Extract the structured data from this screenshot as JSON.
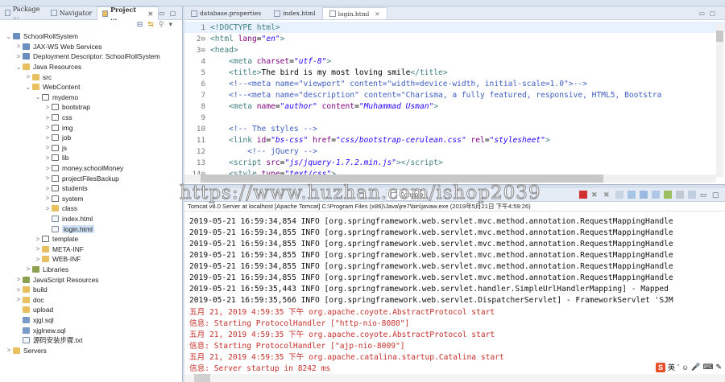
{
  "explorer": {
    "tabs": [
      {
        "label": "Package ..."
      },
      {
        "label": "Navigator"
      },
      {
        "label": "Project ..."
      }
    ],
    "tree": [
      {
        "label": "SchoolRollSystem",
        "depth": 0,
        "arrow": "v",
        "icon": "proj"
      },
      {
        "label": "JAX-WS Web Services",
        "depth": 1,
        "arrow": ">",
        "icon": "proj"
      },
      {
        "label": "Deployment Descriptor: SchoolRollSystem",
        "depth": 1,
        "arrow": ">",
        "icon": "proj"
      },
      {
        "label": "Java Resources",
        "depth": 1,
        "arrow": "v",
        "icon": "fold"
      },
      {
        "label": "src",
        "depth": 2,
        "arrow": ">",
        "icon": "fold"
      },
      {
        "label": "WebContent",
        "depth": 2,
        "arrow": "v",
        "icon": "fold"
      },
      {
        "label": "mydemo",
        "depth": 3,
        "arrow": "v",
        "icon": "pkg"
      },
      {
        "label": "bootstrap",
        "depth": 4,
        "arrow": ">",
        "icon": "pkg"
      },
      {
        "label": "css",
        "depth": 4,
        "arrow": ">",
        "icon": "pkg"
      },
      {
        "label": "img",
        "depth": 4,
        "arrow": ">",
        "icon": "pkg"
      },
      {
        "label": "job",
        "depth": 4,
        "arrow": ">",
        "icon": "pkg"
      },
      {
        "label": "js",
        "depth": 4,
        "arrow": ">",
        "icon": "pkg"
      },
      {
        "label": "lib",
        "depth": 4,
        "arrow": ">",
        "icon": "pkg"
      },
      {
        "label": "money.schoolMoney",
        "depth": 4,
        "arrow": ">",
        "icon": "pkg"
      },
      {
        "label": "projectFilesBackup",
        "depth": 4,
        "arrow": ">",
        "icon": "pkg"
      },
      {
        "label": "students",
        "depth": 4,
        "arrow": ">",
        "icon": "pkg"
      },
      {
        "label": "system",
        "depth": 4,
        "arrow": ">",
        "icon": "pkg"
      },
      {
        "label": "class",
        "depth": 4,
        "arrow": ">",
        "icon": "fold"
      },
      {
        "label": "index.html",
        "depth": 4,
        "arrow": "",
        "icon": "file"
      },
      {
        "label": "login.html",
        "depth": 4,
        "arrow": "",
        "icon": "file",
        "selected": true
      },
      {
        "label": "template",
        "depth": 3,
        "arrow": ">",
        "icon": "pkg"
      },
      {
        "label": "META-INF",
        "depth": 3,
        "arrow": ">",
        "icon": "fold"
      },
      {
        "label": "WEB-INF",
        "depth": 3,
        "arrow": ">",
        "icon": "fold"
      },
      {
        "label": "Libraries",
        "depth": 2,
        "arrow": ">",
        "icon": "lib"
      },
      {
        "label": "JavaScript Resources",
        "depth": 1,
        "arrow": ">",
        "icon": "lib"
      },
      {
        "label": "build",
        "depth": 1,
        "arrow": ">",
        "icon": "fold"
      },
      {
        "label": "doc",
        "depth": 1,
        "arrow": ">",
        "icon": "fold"
      },
      {
        "label": "upload",
        "depth": 1,
        "arrow": "",
        "icon": "fold"
      },
      {
        "label": "xjgl.sql",
        "depth": 1,
        "arrow": "",
        "icon": "sql"
      },
      {
        "label": "xjglnew.sql",
        "depth": 1,
        "arrow": "",
        "icon": "sql"
      },
      {
        "label": "源码安装步骤.txt",
        "depth": 1,
        "arrow": "",
        "icon": "file"
      },
      {
        "label": "Servers",
        "depth": 0,
        "arrow": ">",
        "icon": "fold"
      }
    ]
  },
  "editor": {
    "tabs": [
      {
        "label": "database.properties"
      },
      {
        "label": "index.html"
      },
      {
        "label": "login.html"
      }
    ],
    "lines": [
      {
        "n": "1",
        "parts": [
          [
            "tag",
            "<!DOCTYPE html>"
          ]
        ]
      },
      {
        "n": "2⊖",
        "parts": [
          [
            "tag",
            "<html "
          ],
          [
            "attr",
            "lang"
          ],
          [
            "txt",
            "="
          ],
          [
            "val",
            "\"en\""
          ],
          [
            "tag",
            ">"
          ]
        ]
      },
      {
        "n": "3⊖",
        "parts": [
          [
            "tag",
            "<head>"
          ]
        ]
      },
      {
        "n": "4",
        "parts": [
          [
            "txt",
            "    "
          ],
          [
            "tag",
            "<meta "
          ],
          [
            "attr",
            "charset"
          ],
          [
            "txt",
            "="
          ],
          [
            "val",
            "\"utf-8\""
          ],
          [
            "tag",
            ">"
          ]
        ]
      },
      {
        "n": "5",
        "parts": [
          [
            "txt",
            "    "
          ],
          [
            "tag",
            "<title>"
          ],
          [
            "txt",
            "The bird is my most loving smile"
          ],
          [
            "tag",
            "</title>"
          ]
        ]
      },
      {
        "n": "6",
        "parts": [
          [
            "txt",
            "    "
          ],
          [
            "cmt",
            "<!--<meta name=\"viewport\" content=\"width=device-width, initial-scale=1.0\">-->"
          ]
        ]
      },
      {
        "n": "7",
        "parts": [
          [
            "txt",
            "    "
          ],
          [
            "cmt",
            "<!--<meta name=\"description\" content=\"Charisma, a fully featured, responsive, HTML5, Bootstra"
          ]
        ]
      },
      {
        "n": "8",
        "parts": [
          [
            "txt",
            "    "
          ],
          [
            "tag",
            "<meta "
          ],
          [
            "attr",
            "name"
          ],
          [
            "txt",
            "="
          ],
          [
            "val",
            "\"author\""
          ],
          [
            "attr",
            " content"
          ],
          [
            "txt",
            "="
          ],
          [
            "val",
            "\"Muhammad Usman\""
          ],
          [
            "tag",
            ">"
          ]
        ]
      },
      {
        "n": "9",
        "parts": []
      },
      {
        "n": "10",
        "parts": [
          [
            "txt",
            "    "
          ],
          [
            "cmt",
            "<!-- The styles -->"
          ]
        ]
      },
      {
        "n": "11",
        "parts": [
          [
            "txt",
            "    "
          ],
          [
            "tag",
            "<link "
          ],
          [
            "attr",
            "id"
          ],
          [
            "txt",
            "="
          ],
          [
            "val",
            "\"bs-css\""
          ],
          [
            "attr",
            " href"
          ],
          [
            "txt",
            "="
          ],
          [
            "val",
            "\"css/bootstrap-cerulean.css\""
          ],
          [
            "attr",
            " rel"
          ],
          [
            "txt",
            "="
          ],
          [
            "val",
            "\"stylesheet\""
          ],
          [
            "tag",
            ">"
          ]
        ]
      },
      {
        "n": "12",
        "parts": [
          [
            "txt",
            "        "
          ],
          [
            "cmt",
            "<!-- jQuery -->"
          ]
        ]
      },
      {
        "n": "13",
        "parts": [
          [
            "txt",
            "    "
          ],
          [
            "tag",
            "<script "
          ],
          [
            "attr",
            "src"
          ],
          [
            "txt",
            "="
          ],
          [
            "val",
            "\"js/jquery-1.7.2.min.js\""
          ],
          [
            "tag",
            "></script>"
          ]
        ]
      },
      {
        "n": "14⊖",
        "parts": [
          [
            "txt",
            "    "
          ],
          [
            "tag",
            "<style "
          ],
          [
            "attr",
            "type"
          ],
          [
            "txt",
            "="
          ],
          [
            "val",
            "\"text/css\""
          ],
          [
            "tag",
            ">"
          ]
        ]
      }
    ]
  },
  "console": {
    "tab_label": "Console",
    "watermark": "https://www.huzhan.com/ishop2039",
    "header": "Tomcat v8.0 Server at localhost [Apache Tomcat] C:\\Program Files (x86)\\Java\\jre7\\bin\\javaw.exe (2019年5月21日 下午4:59:26)",
    "lines": [
      {
        "style": "blk",
        "text": "2019-05-21 16:59:34,854 INFO [org.springframework.web.servlet.mvc.method.annotation.RequestMappingHandle"
      },
      {
        "style": "blk",
        "text": "2019-05-21 16:59:34,855 INFO [org.springframework.web.servlet.mvc.method.annotation.RequestMappingHandle"
      },
      {
        "style": "blk",
        "text": "2019-05-21 16:59:34,855 INFO [org.springframework.web.servlet.mvc.method.annotation.RequestMappingHandle"
      },
      {
        "style": "blk",
        "text": "2019-05-21 16:59:34,855 INFO [org.springframework.web.servlet.mvc.method.annotation.RequestMappingHandle"
      },
      {
        "style": "blk",
        "text": "2019-05-21 16:59:34,855 INFO [org.springframework.web.servlet.mvc.method.annotation.RequestMappingHandle"
      },
      {
        "style": "blk",
        "text": "2019-05-21 16:59:34,855 INFO [org.springframework.web.servlet.mvc.method.annotation.RequestMappingHandle"
      },
      {
        "style": "blk",
        "text": "2019-05-21 16:59:35,443 INFO [org.springframework.web.servlet.handler.SimpleUrlHandlerMapping] - Mapped"
      },
      {
        "style": "blk",
        "text": "2019-05-21 16:59:35,566 INFO [org.springframework.web.servlet.DispatcherServlet] - FrameworkServlet 'SJM"
      },
      {
        "style": "red",
        "text": "五月 21, 2019 4:59:35 下午 org.apache.coyote.AbstractProtocol start"
      },
      {
        "style": "red",
        "text": "信息: Starting ProtocolHandler [\"http-nio-8080\"]"
      },
      {
        "style": "red",
        "text": "五月 21, 2019 4:59:35 下午 org.apache.coyote.AbstractProtocol start"
      },
      {
        "style": "red",
        "text": "信息: Starting ProtocolHandler [\"ajp-nio-8009\"]"
      },
      {
        "style": "red",
        "text": "五月 21, 2019 4:59:35 下午 org.apache.catalina.startup.Catalina start"
      },
      {
        "style": "red",
        "text": "信息: Server startup in 8242 ms"
      }
    ]
  },
  "ime": {
    "logo": "S",
    "mode": "英"
  }
}
